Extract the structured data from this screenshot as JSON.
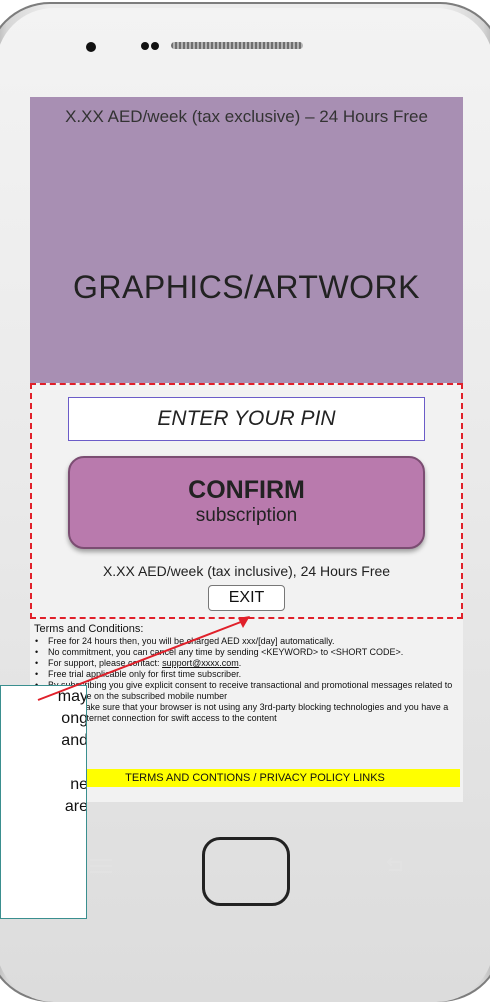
{
  "hero": {
    "price_top": "X.XX AED/week (tax exclusive) – 24 Hours Free",
    "artwork_label": "GRAPHICS/ARTWORK"
  },
  "form": {
    "pin_placeholder": "ENTER YOUR PIN",
    "confirm_label": "CONFIRM",
    "confirm_sub": "subscription",
    "price_bottom": "X.XX AED/week (tax inclusive), 24 Hours Free",
    "exit_label": "EXIT"
  },
  "terms": {
    "title": "Terms and Conditions:",
    "items": [
      "Free for 24 hours then, you will be charged AED xxx/[day] automatically.",
      "No commitment, you can cancel any time by sending <KEYWORD> to <SHORT CODE>.",
      "For support, please contact: ",
      "Free trial applicable only for first time subscriber.",
      "By subscribing you give explicit consent to receive transactional and promotional messages related to the service on the subscribed mobile number",
      "Please make sure that your browser is not using any 3rd-party blocking technologies and you have a healthy internet connection for swift access to the content"
    ],
    "support_email": "support@xxxx.com",
    "support_suffix": "."
  },
  "policy_links": "TERMS AND CONTIONS / PRIVACY POLICY LINKS",
  "callout": {
    "lines": [
      "may",
      "ong",
      "and",
      "",
      "ne",
      "are"
    ]
  },
  "colors": {
    "hero_bg": "#a88fb3",
    "confirm_bg": "#b97aad",
    "dashed_border": "#e0202a",
    "policy_bg": "#ffff00",
    "arrow": "#e0202a"
  },
  "icons": [
    "front-camera-icon",
    "sensor-icon",
    "speaker-grille-icon",
    "menu-icon",
    "back-icon",
    "home-button"
  ]
}
